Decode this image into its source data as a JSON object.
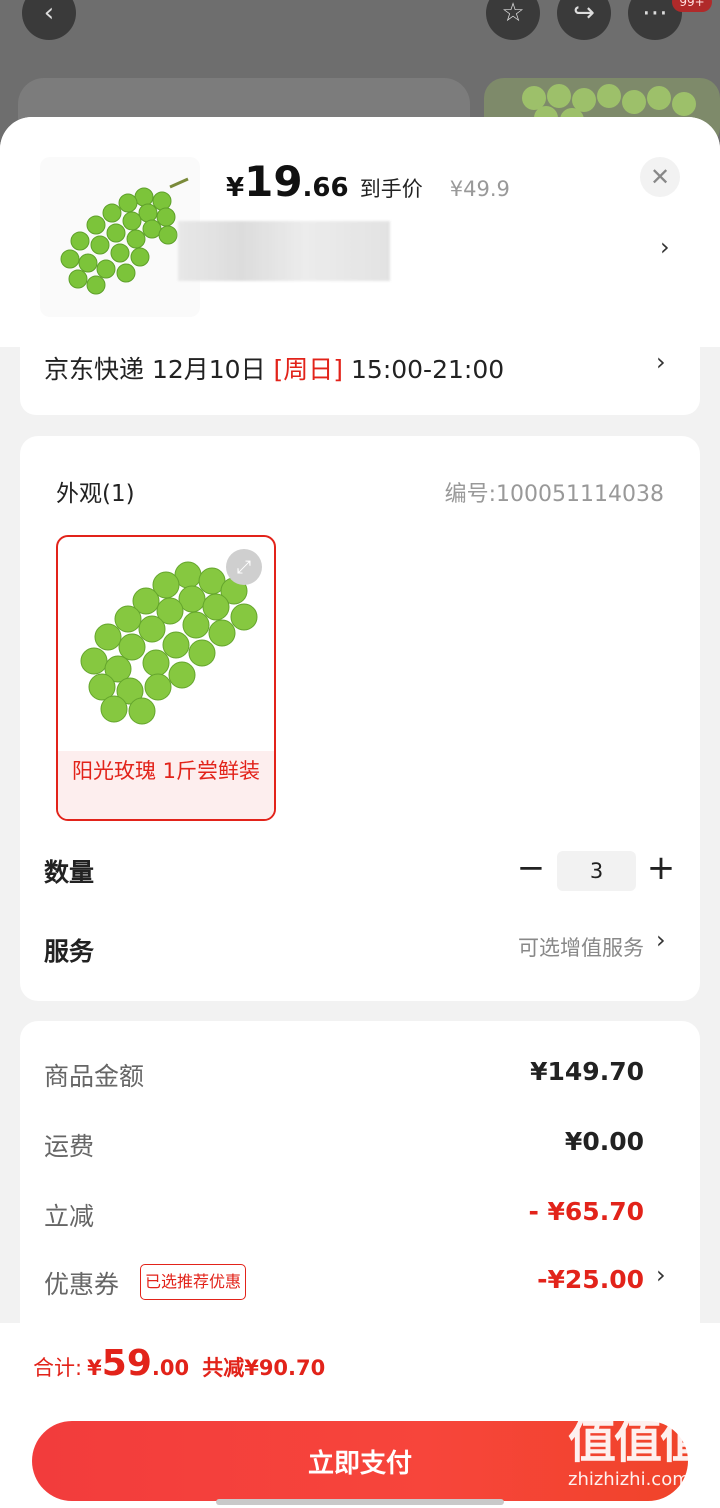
{
  "background": {
    "badge": "99+"
  },
  "product": {
    "price_yen": "¥",
    "price_int": "19",
    "price_dec": ".66",
    "price_tag": "到手价",
    "original_price": "¥49.9"
  },
  "delivery": {
    "carrier": "京东快递",
    "date": "12月10日",
    "weekday": "[周日]",
    "time": "15:00-21:00"
  },
  "spec": {
    "title": "外观(1)",
    "code": "编号:100051114038",
    "options": [
      {
        "label": "阳光玫瑰 1斤尝鲜装",
        "selected": true
      }
    ]
  },
  "quantity": {
    "label": "数量",
    "minus": "−",
    "value": "3",
    "plus": "+"
  },
  "service": {
    "label": "服务",
    "value": "可选增值服务"
  },
  "price_detail": {
    "rows": [
      {
        "label": "商品金额",
        "value": "¥149.70"
      },
      {
        "label": "运费",
        "value": "¥0.00"
      },
      {
        "label": "立减",
        "value": "- ¥65.70"
      },
      {
        "label": "优惠券",
        "tag": "已选推荐优惠",
        "value": "-¥25.00"
      }
    ]
  },
  "footer": {
    "total_label": "合计:",
    "total_yen": "¥",
    "total_int": "59",
    "total_dec": ".00",
    "saved": "共减¥90.70",
    "pay_button": "立即支付"
  },
  "watermark": {
    "big": "值值值",
    "small": "zhizhizhi.com"
  },
  "colors": {
    "accent": "#e2231a",
    "pay_button": "#f23c3c"
  }
}
